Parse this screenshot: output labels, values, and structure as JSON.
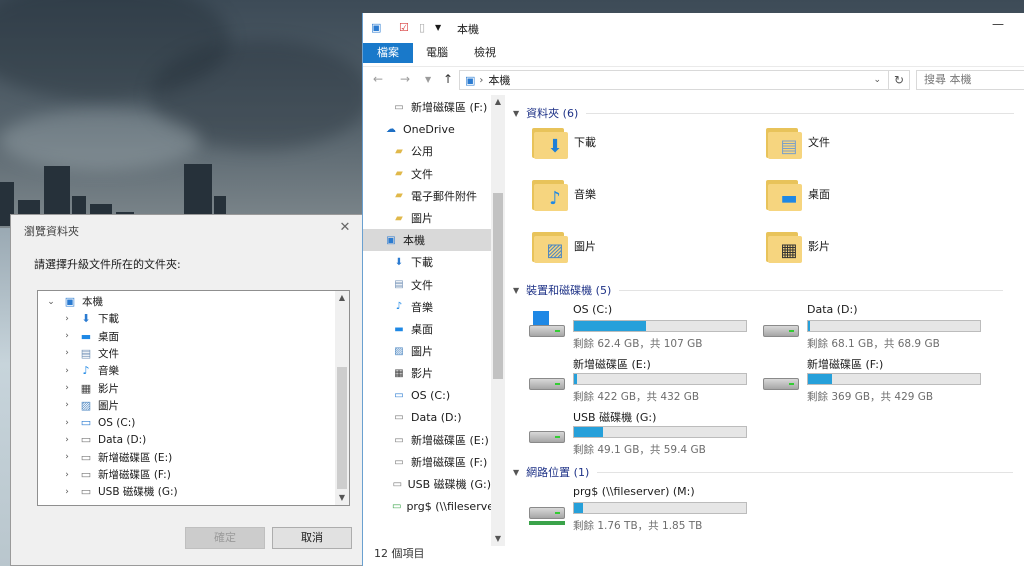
{
  "dialog": {
    "title": "瀏覽資料夾",
    "close_glyph": "✕",
    "prompt": "請選擇升級文件所在的文件夾:",
    "tree": [
      {
        "label": "本機",
        "icon": "computer-icon",
        "expanded": true,
        "level": 0
      },
      {
        "label": "下載",
        "icon": "download-folder-icon",
        "level": 1
      },
      {
        "label": "桌面",
        "icon": "desktop-folder-icon",
        "level": 1
      },
      {
        "label": "文件",
        "icon": "documents-folder-icon",
        "level": 1
      },
      {
        "label": "音樂",
        "icon": "music-folder-icon",
        "level": 1
      },
      {
        "label": "影片",
        "icon": "video-folder-icon",
        "level": 1
      },
      {
        "label": "圖片",
        "icon": "pictures-folder-icon",
        "level": 1
      },
      {
        "label": "OS (C:)",
        "icon": "os-drive-icon",
        "level": 1
      },
      {
        "label": "Data (D:)",
        "icon": "drive-icon",
        "level": 1
      },
      {
        "label": "新增磁碟區 (E:)",
        "icon": "drive-icon",
        "level": 1
      },
      {
        "label": "新增磁碟區 (F:)",
        "icon": "drive-icon",
        "level": 1
      },
      {
        "label": "USB 磁碟機 (G:)",
        "icon": "usb-drive-icon",
        "level": 1
      }
    ],
    "ok_label": "確定",
    "cancel_label": "取消"
  },
  "explorer": {
    "title": "本機",
    "ribbon_tabs": [
      "檔案",
      "電腦",
      "檢視"
    ],
    "address": "本機",
    "search_placeholder": "搜尋 本機",
    "nav": [
      {
        "label": "新增磁碟區 (F:)",
        "icon": "drive-icon"
      },
      {
        "label": "OneDrive",
        "icon": "onedrive-icon"
      },
      {
        "label": "公用",
        "icon": "onedrive-folder-icon"
      },
      {
        "label": "文件",
        "icon": "onedrive-folder-icon"
      },
      {
        "label": "電子郵件附件",
        "icon": "onedrive-folder-icon"
      },
      {
        "label": "圖片",
        "icon": "onedrive-folder-icon"
      },
      {
        "label": "本機",
        "icon": "computer-icon",
        "selected": true
      },
      {
        "label": "下載",
        "icon": "download-folder-icon"
      },
      {
        "label": "文件",
        "icon": "documents-folder-icon"
      },
      {
        "label": "音樂",
        "icon": "music-folder-icon"
      },
      {
        "label": "桌面",
        "icon": "desktop-folder-icon"
      },
      {
        "label": "圖片",
        "icon": "pictures-folder-icon"
      },
      {
        "label": "影片",
        "icon": "video-folder-icon"
      },
      {
        "label": "OS (C:)",
        "icon": "os-drive-icon"
      },
      {
        "label": "Data (D:)",
        "icon": "drive-icon"
      },
      {
        "label": "新增磁碟區 (E:)",
        "icon": "drive-icon"
      },
      {
        "label": "新增磁碟區 (F:)",
        "icon": "drive-icon"
      },
      {
        "label": "USB 磁碟機 (G:)",
        "icon": "usb-drive-icon"
      },
      {
        "label": "prg$ (\\\\fileserver",
        "icon": "network-drive-icon"
      }
    ],
    "status": "12 個項目",
    "folders_header": "資料夾 (6)",
    "folders": [
      {
        "label": "下載",
        "icon": "download-folder-icon"
      },
      {
        "label": "文件",
        "icon": "documents-folder-icon"
      },
      {
        "label": "音樂",
        "icon": "music-folder-icon"
      },
      {
        "label": "桌面",
        "icon": "desktop-folder-icon"
      },
      {
        "label": "圖片",
        "icon": "pictures-folder-icon"
      },
      {
        "label": "影片",
        "icon": "video-folder-icon"
      }
    ],
    "devices_header": "裝置和磁碟機 (5)",
    "drives": [
      {
        "name": "OS (C:)",
        "space": "剩餘 62.4 GB，共 107 GB",
        "used_fraction": 0.42,
        "icon": "os-drive-icon"
      },
      {
        "name": "Data (D:)",
        "space": "剩餘 68.1 GB，共 68.9 GB",
        "used_fraction": 0.01,
        "icon": "drive-icon"
      },
      {
        "name": "新增磁碟區 (E:)",
        "space": "剩餘 422 GB，共 432 GB",
        "used_fraction": 0.02,
        "icon": "drive-icon"
      },
      {
        "name": "新增磁碟區 (F:)",
        "space": "剩餘 369 GB，共 429 GB",
        "used_fraction": 0.14,
        "icon": "drive-icon"
      },
      {
        "name": "USB 磁碟機 (G:)",
        "space": "剩餘 49.1 GB，共 59.4 GB",
        "used_fraction": 0.17,
        "icon": "usb-drive-icon"
      }
    ],
    "network_header": "網路位置 (1)",
    "network": [
      {
        "name": "prg$ (\\\\fileserver) (M:)",
        "space": "剩餘 1.76 TB，共 1.85 TB",
        "used_fraction": 0.05,
        "icon": "network-drive-icon"
      }
    ]
  },
  "colors": {
    "accent": "#1979ca",
    "bar_fill": "#26a0da",
    "folder": "#f6d57f"
  }
}
